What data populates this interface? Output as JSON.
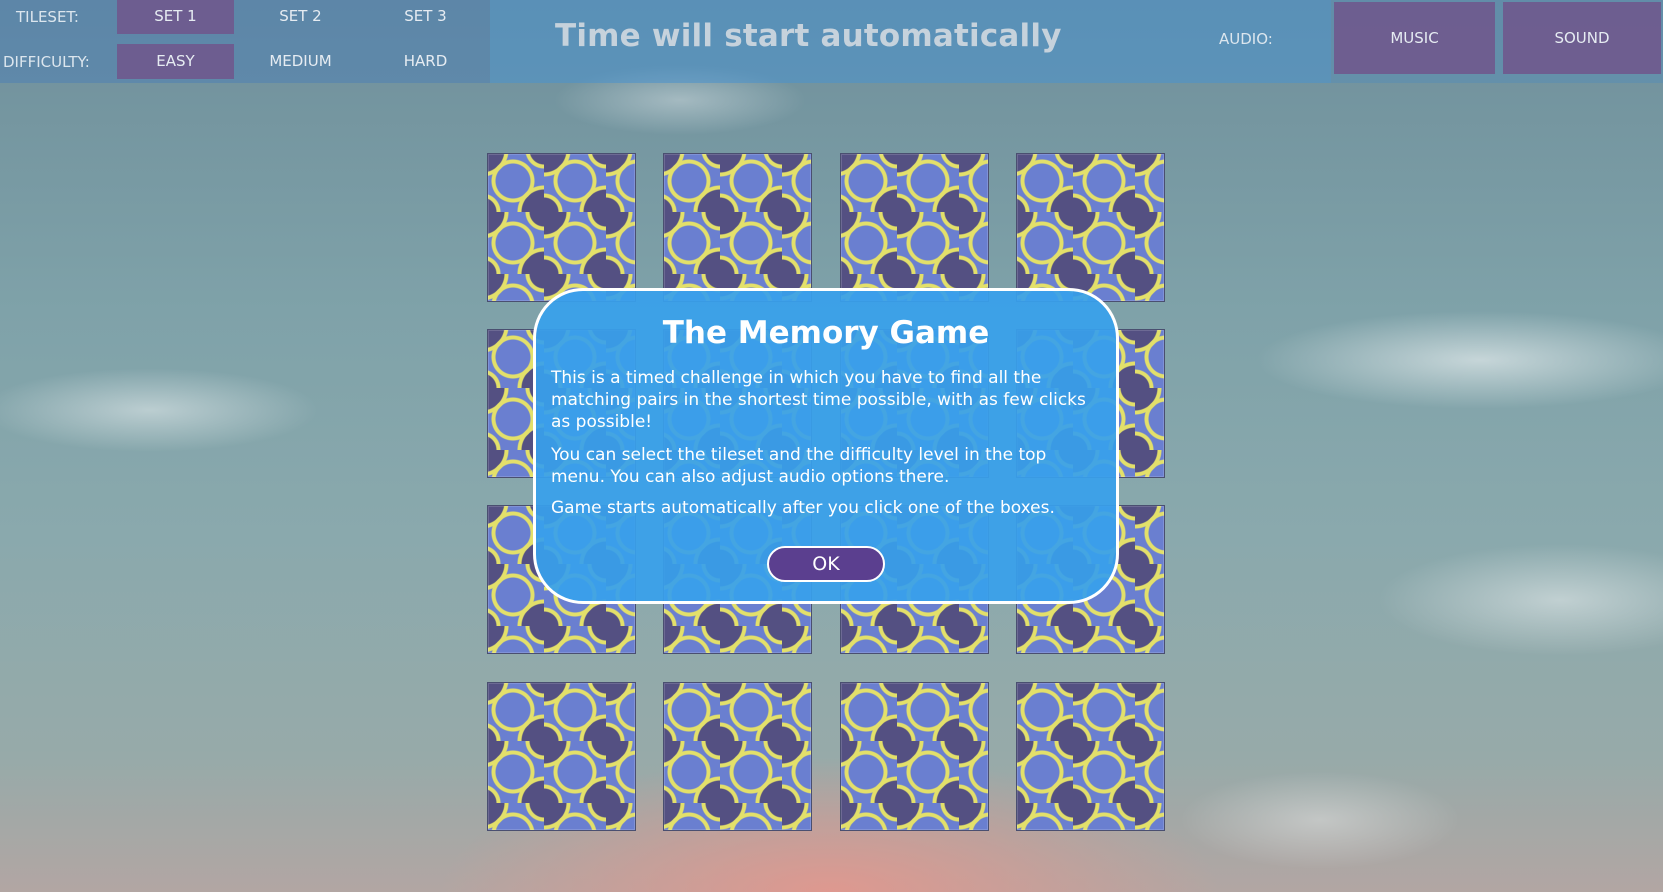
{
  "menu": {
    "tileset_label": "TILESET:",
    "tilesets": [
      "SET 1",
      "SET 2",
      "SET 3"
    ],
    "selected_tileset": "SET 1",
    "difficulty_label": "DIFFICULTY:",
    "difficulties": [
      "EASY",
      "MEDIUM",
      "HARD"
    ],
    "selected_difficulty": "EASY",
    "status": "Time will start automatically",
    "audio_label": "AUDIO:",
    "music_label": "MUSIC",
    "sound_label": "SOUND"
  },
  "board": {
    "rows": 4,
    "columns": 4,
    "tile_face": "face-down pattern tile"
  },
  "dialog": {
    "title": "The Memory Game",
    "paragraph1": "This is a timed challenge in which you have to find all the matching pairs in the shortest time possible, with as few clicks as possible!",
    "paragraph2": "You can select the tileset and the difficulty level in the top menu. You can also adjust audio options there.",
    "paragraph3": "Game starts automatically after you click one of the boxes.",
    "ok_label": "OK"
  },
  "colors": {
    "dialog_bg": "#38a0ec",
    "button_purple": "#5b3f8f",
    "tile_blue": "#6a7fd0",
    "tile_line": "#e3e06a"
  }
}
